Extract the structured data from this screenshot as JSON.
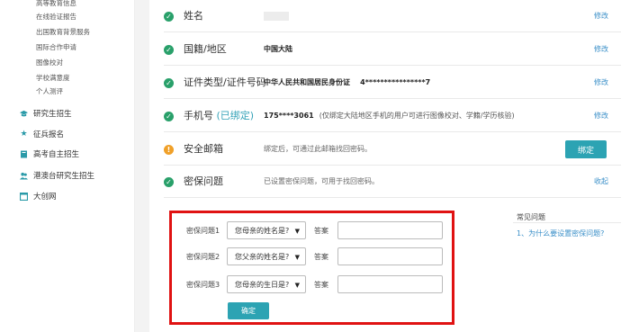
{
  "sidebar": {
    "sub_items": [
      "高等教育信息",
      "在线验证报告",
      "出国教育背景服务",
      "国际合作申请",
      "图像校对",
      "学校满意度",
      "个人测评"
    ],
    "sections": [
      {
        "label": "研究生招生",
        "icon": "graduation-cap-icon"
      },
      {
        "label": "征兵报名",
        "icon": "star-icon"
      },
      {
        "label": "高考自主招生",
        "icon": "book-icon"
      },
      {
        "label": "港澳台研究生招生",
        "icon": "people-icon"
      },
      {
        "label": "大创网",
        "icon": "window-icon"
      }
    ]
  },
  "rows": {
    "name": {
      "label": "姓名",
      "action": "修改"
    },
    "nationality": {
      "label": "国籍/地区",
      "value": "中国大陆",
      "action": "修改"
    },
    "id_doc": {
      "label": "证件类型/证件号码",
      "value": "中华人民共和国居民身份证",
      "number": "4****************7",
      "action": "修改"
    },
    "phone": {
      "label": "手机号",
      "tag": "(已绑定)",
      "value": "175****3061",
      "note": "(仅绑定大陆地区手机的用户可进行图像校对、学籍/学历核验)",
      "action": "修改"
    },
    "email": {
      "label": "安全邮箱",
      "value": "绑定后，可通过此邮箱找回密码。",
      "button": "绑定"
    },
    "security": {
      "label": "密保问题",
      "value": "已设置密保问题，可用于找回密码。",
      "action": "收起"
    }
  },
  "questions": {
    "answer_label": "答案",
    "items": [
      {
        "label": "密保问题1",
        "selected": "您母亲的姓名是?"
      },
      {
        "label": "密保问题2",
        "selected": "您父亲的姓名是?"
      },
      {
        "label": "密保问题3",
        "selected": "您母亲的生日是?"
      }
    ],
    "confirm": "确定"
  },
  "faq": {
    "title": "常见问题",
    "items": [
      "1、为什么要设置密保问题?"
    ]
  },
  "colors": {
    "accent": "#2ca3b3",
    "ok": "#29a06a",
    "warn": "#f0a028",
    "highlight_border": "#e01212",
    "link": "#3a8fc8"
  }
}
